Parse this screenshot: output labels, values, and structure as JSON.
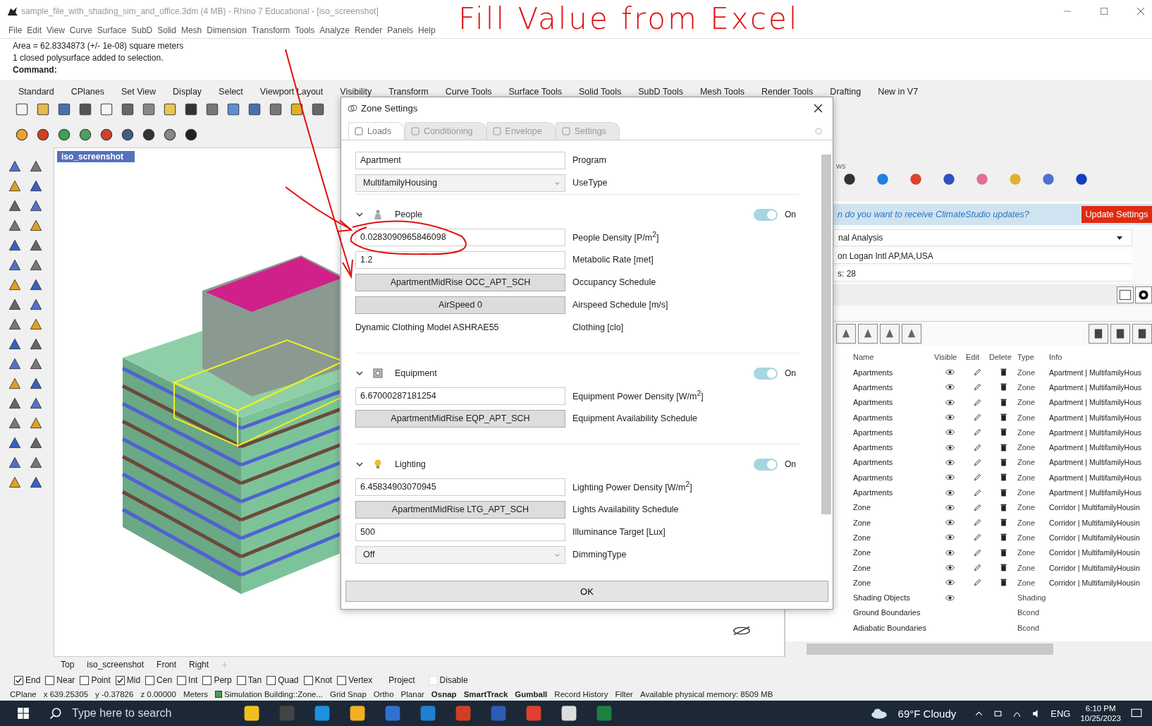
{
  "window": {
    "title": "sample_file_with_shading_sim_and_office.3dm (4 MB) - Rhino 7 Educational - [iso_screenshot]"
  },
  "menu": [
    "File",
    "Edit",
    "View",
    "Curve",
    "Surface",
    "SubD",
    "Solid",
    "Mesh",
    "Dimension",
    "Transform",
    "Tools",
    "Analyze",
    "Render",
    "Panels",
    "Help"
  ],
  "command_history": [
    "Area = 62.8334873 (+/- 1e-08) square meters",
    "1 closed polysurface added to selection."
  ],
  "command_prompt": "Command:",
  "toolbar_tabs": [
    "Standard",
    "CPlanes",
    "Set View",
    "Display",
    "Select",
    "Viewport Layout",
    "Visibility",
    "Transform",
    "Curve Tools",
    "Surface Tools",
    "Solid Tools",
    "SubD Tools",
    "Mesh Tools",
    "Render Tools",
    "Drafting",
    "New in V7"
  ],
  "viewport": {
    "tab": "iso_screenshot"
  },
  "dialog": {
    "title": "Zone Settings",
    "tabs": [
      {
        "label": "Loads",
        "selected": true
      },
      {
        "label": "Conditioning",
        "selected": false
      },
      {
        "label": "Envelope",
        "selected": false
      },
      {
        "label": "Settings",
        "selected": false
      }
    ],
    "top_fields": [
      {
        "kind": "input",
        "value": "Apartment",
        "label": "Program"
      },
      {
        "kind": "select",
        "value": "MultifamilyHousing",
        "label": "UseType"
      }
    ],
    "sections": [
      {
        "title": "People",
        "expanded": true,
        "on": true,
        "toggle_label": "On",
        "fields": [
          {
            "kind": "input",
            "value": "0.0283090965846098",
            "label": "People Density [P/m$^{2}$]"
          },
          {
            "kind": "input",
            "value": "1.2",
            "label": "Metabolic Rate [met]"
          },
          {
            "kind": "button",
            "value": "ApartmentMidRise OCC_APT_SCH",
            "label": "Occupancy Schedule"
          },
          {
            "kind": "button",
            "value": "AirSpeed 0",
            "label": "Airspeed Schedule [m/s]"
          },
          {
            "kind": "text",
            "value": "Dynamic Clothing Model ASHRAE55",
            "label": "Clothing [clo]"
          }
        ]
      },
      {
        "title": "Equipment",
        "expanded": true,
        "on": true,
        "toggle_label": "On",
        "fields": [
          {
            "kind": "input",
            "value": "6.67000287181254",
            "label": "Equipment Power Density [W/m$^{2}$]"
          },
          {
            "kind": "button",
            "value": "ApartmentMidRise EQP_APT_SCH",
            "label": "Equipment Availability  Schedule"
          }
        ]
      },
      {
        "title": "Lighting",
        "expanded": true,
        "on": true,
        "toggle_label": "On",
        "fields": [
          {
            "kind": "input",
            "value": "6.45834903070945",
            "label": "Lighting Power Density [W/m$^{2}$]"
          },
          {
            "kind": "button",
            "value": "ApartmentMidRise LTG_APT_SCH",
            "label": "Lights Availability Schedule"
          },
          {
            "kind": "input",
            "value": "500",
            "label": "Illuminance Target [Lux]"
          },
          {
            "kind": "select",
            "value": "Off",
            "label": "DimmingType"
          }
        ]
      }
    ],
    "ok": "OK"
  },
  "panel": {
    "toolbar_label": "ws",
    "banner": {
      "text": "n do you want to receive ClimateStudio updates?",
      "button": "Update Settings"
    },
    "analysis_select": "nal Analysis",
    "weather_file": "on Logan Intl AP,MA,USA",
    "field_3": "s: 28",
    "table": {
      "columns": [
        "Name",
        "Visible",
        "Edit",
        "Delete",
        "Type",
        "Info"
      ],
      "rows": [
        {
          "name": "Apartments",
          "visible": true,
          "editable": true,
          "type": "Zone",
          "info": "Apartment | MultifamilyHous"
        },
        {
          "name": "Apartments",
          "visible": true,
          "editable": true,
          "type": "Zone",
          "info": "Apartment | MultifamilyHous"
        },
        {
          "name": "Apartments",
          "visible": true,
          "editable": true,
          "type": "Zone",
          "info": "Apartment | MultifamilyHous"
        },
        {
          "name": "Apartments",
          "visible": true,
          "editable": true,
          "type": "Zone",
          "info": "Apartment | MultifamilyHous"
        },
        {
          "name": "Apartments",
          "visible": true,
          "editable": true,
          "type": "Zone",
          "info": "Apartment | MultifamilyHous"
        },
        {
          "name": "Apartments",
          "visible": true,
          "editable": true,
          "type": "Zone",
          "info": "Apartment | MultifamilyHous"
        },
        {
          "name": "Apartments",
          "visible": true,
          "editable": true,
          "type": "Zone",
          "info": "Apartment | MultifamilyHous"
        },
        {
          "name": "Apartments",
          "visible": true,
          "editable": true,
          "type": "Zone",
          "info": "Apartment | MultifamilyHous"
        },
        {
          "name": "Apartments",
          "visible": true,
          "editable": true,
          "type": "Zone",
          "info": "Apartment | MultifamilyHous"
        },
        {
          "name": "Zone",
          "visible": true,
          "editable": true,
          "type": "Zone",
          "info": "Corridor | MultifamilyHousin"
        },
        {
          "name": "Zone",
          "visible": true,
          "editable": true,
          "type": "Zone",
          "info": "Corridor | MultifamilyHousin"
        },
        {
          "name": "Zone",
          "visible": true,
          "editable": true,
          "type": "Zone",
          "info": "Corridor | MultifamilyHousin"
        },
        {
          "name": "Zone",
          "visible": true,
          "editable": true,
          "type": "Zone",
          "info": "Corridor | MultifamilyHousin"
        },
        {
          "name": "Zone",
          "visible": true,
          "editable": true,
          "type": "Zone",
          "info": "Corridor | MultifamilyHousin"
        },
        {
          "name": "Zone",
          "visible": true,
          "editable": true,
          "type": "Zone",
          "info": "Corridor | MultifamilyHousin"
        },
        {
          "name": "Shading Objects",
          "visible": true,
          "editable": false,
          "type": "Shading"
        },
        {
          "name": "Ground Boundaries",
          "visible": false,
          "editable": false,
          "type": "Bcond"
        },
        {
          "name": "Adiabatic Boundaries",
          "visible": false,
          "editable": false,
          "type": "Bcond"
        }
      ]
    }
  },
  "viewport_tabs": [
    "Top",
    "iso_screenshot",
    "Front",
    "Right"
  ],
  "osnaps": [
    {
      "kind": "checkbox",
      "label": "End",
      "checked": true
    },
    {
      "kind": "checkbox",
      "label": "Near",
      "checked": false
    },
    {
      "kind": "checkbox",
      "label": "Point",
      "checked": false
    },
    {
      "kind": "checkbox",
      "label": "Mid",
      "checked": true
    },
    {
      "kind": "checkbox",
      "label": "Cen",
      "checked": false
    },
    {
      "kind": "checkbox",
      "label": "Int",
      "checked": false
    },
    {
      "kind": "checkbox",
      "label": "Perp",
      "checked": false
    },
    {
      "kind": "checkbox",
      "label": "Tan",
      "checked": false
    },
    {
      "kind": "checkbox",
      "label": "Quad",
      "checked": false
    },
    {
      "kind": "checkbox",
      "label": "Knot",
      "checked": false
    },
    {
      "kind": "checkbox",
      "label": "Vertex",
      "checked": false
    },
    {
      "kind": "plain",
      "label": "Project"
    },
    {
      "kind": "checkbox",
      "label": "Disable",
      "checked": false
    }
  ],
  "status_bar": [
    {
      "kind": "text",
      "text": "CPlane",
      "bold": false
    },
    {
      "kind": "text",
      "text": "x 639.25305",
      "bold": false
    },
    {
      "kind": "text",
      "text": "y -0.37826",
      "bold": false
    },
    {
      "kind": "text",
      "text": "z 0.00000",
      "bold": false
    },
    {
      "kind": "text",
      "text": "Meters",
      "bold": false
    },
    {
      "kind": "layer",
      "text": "Simulation Building::Zone...",
      "bold": false
    },
    {
      "kind": "text",
      "text": "Grid Snap",
      "bold": false
    },
    {
      "kind": "text",
      "text": "Ortho",
      "bold": false
    },
    {
      "kind": "text",
      "text": "Planar",
      "bold": false
    },
    {
      "kind": "text",
      "text": "Osnap",
      "bold": true
    },
    {
      "kind": "text",
      "text": "SmartTrack",
      "bold": true
    },
    {
      "kind": "text",
      "text": "Gumball",
      "bold": true
    },
    {
      "kind": "text",
      "text": "Record History",
      "bold": false
    },
    {
      "kind": "text",
      "text": "Filter",
      "bold": false
    },
    {
      "kind": "text",
      "text": "Available physical memory: 8509 MB",
      "bold": false
    }
  ],
  "taskbar": {
    "search_placeholder": "Type here to search",
    "weather": "69°F Cloudy",
    "language": "ENG",
    "time": "6:10 PM",
    "date": "10/25/2023"
  },
  "annotation": {
    "text": "Fill Value from Excel"
  }
}
